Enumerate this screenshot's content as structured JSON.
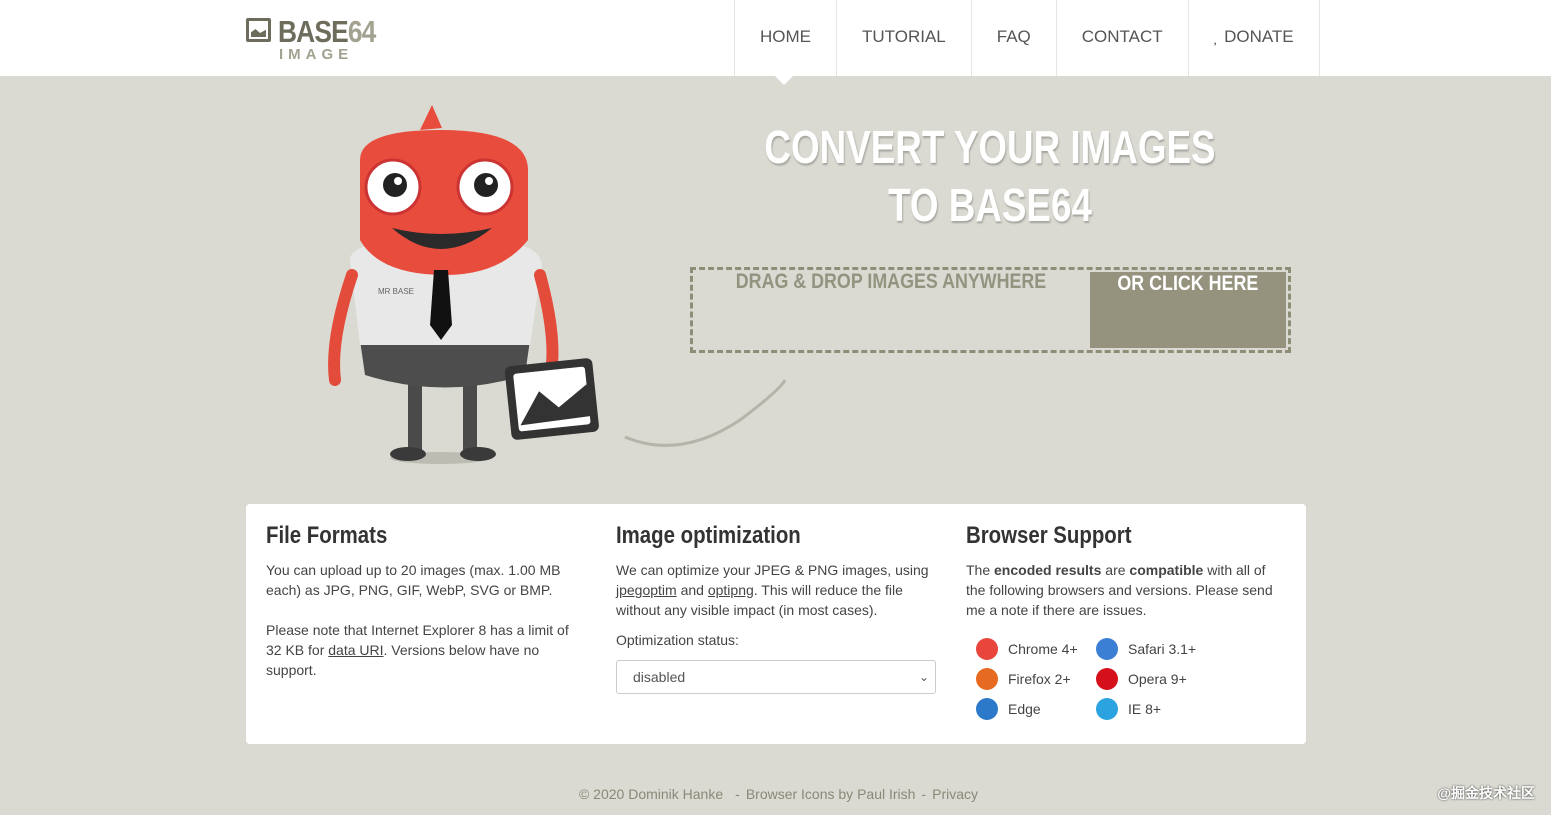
{
  "header": {
    "logo_main": "BASE",
    "logo_num": "64",
    "logo_sub": "IMAGE",
    "nav": [
      {
        "label": "HOME"
      },
      {
        "label": "TUTORIAL"
      },
      {
        "label": "FAQ"
      },
      {
        "label": "CONTACT"
      },
      {
        "label": " DONATE"
      }
    ]
  },
  "hero": {
    "title_line1": "CONVERT YOUR IMAGES",
    "title_line2": "TO BASE64",
    "drop_label": "DRAG & DROP IMAGES ANYWHERE",
    "click_label": "OR CLICK HERE",
    "mascot_shirt": "MR BASE"
  },
  "formats": {
    "title": "File Formats",
    "p1": "You can upload up to 20 images (max. 1.00 MB each) as JPG, PNG, GIF, WebP, SVG or BMP.",
    "p2_a": "Please note that Internet Explorer 8 has a limit of 32 KB for ",
    "p2_link": "data URI",
    "p2_b": ". Versions below have no support."
  },
  "optimization": {
    "title": "Image optimization",
    "p_a": "We can optimize your JPEG & PNG images, using ",
    "link1": "jpegoptim",
    "p_b": " and ",
    "link2": "optipng",
    "p_c": ". This will reduce the file without any visible impact (in most cases).",
    "status_label": "Optimization status:",
    "status_value": "disabled"
  },
  "support": {
    "title": "Browser Support",
    "p_a": "The ",
    "b1": "encoded results",
    "p_b": " are ",
    "b2": "compatible",
    "p_c": " with all of the following browsers and versions. Please send me a note if there are issues.",
    "browsers": [
      {
        "name": "Chrome 4+",
        "icon": "chrome-icon",
        "color": "#e8453c"
      },
      {
        "name": "Safari 3.1+",
        "icon": "safari-icon",
        "color": "#3b7fd4"
      },
      {
        "name": "Firefox 2+",
        "icon": "firefox-icon",
        "color": "#e66a1f"
      },
      {
        "name": "Opera 9+",
        "icon": "opera-icon",
        "color": "#d6101a"
      },
      {
        "name": "Edge",
        "icon": "edge-icon",
        "color": "#2c79c9"
      },
      {
        "name": "IE 8+",
        "icon": "ie-icon",
        "color": "#2aa3e0"
      }
    ]
  },
  "footer": {
    "copyright": "© 2020 Dominik Hanke",
    "sep": "-",
    "icons": "Browser Icons by Paul Irish",
    "privacy": "Privacy"
  },
  "watermark": "@掘金技术社区"
}
